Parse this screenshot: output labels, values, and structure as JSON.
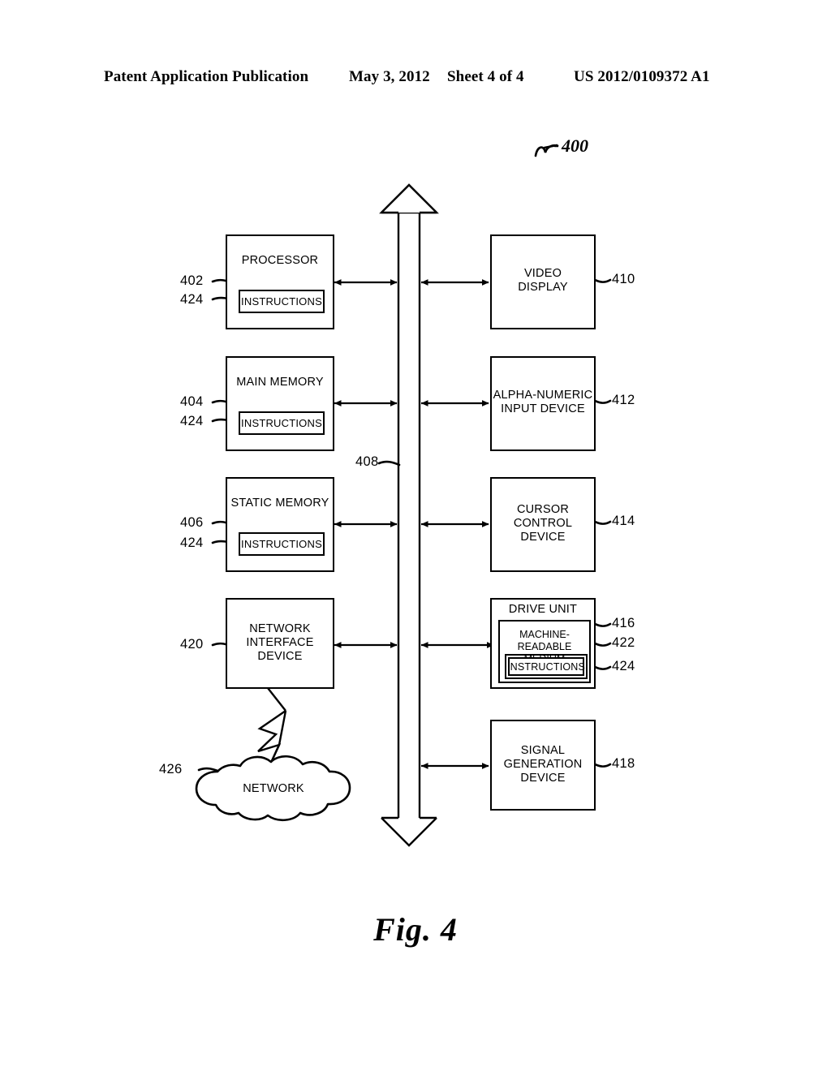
{
  "header": {
    "publication": "Patent Application Publication",
    "date": "May 3, 2012",
    "sheet": "Sheet 4 of 4",
    "patent_number": "US 2012/0109372 A1"
  },
  "figure": {
    "caption": "Fig. 4",
    "system_ref": "400",
    "bus_ref": "408",
    "bus_name": "bus"
  },
  "left_blocks": [
    {
      "title": "PROCESSOR",
      "ref": "402",
      "inner_label": "INSTRUCTIONS",
      "inner_ref": "424"
    },
    {
      "title": "MAIN MEMORY",
      "ref": "404",
      "inner_label": "INSTRUCTIONS",
      "inner_ref": "424"
    },
    {
      "title": "STATIC MEMORY",
      "ref": "406",
      "inner_label": "INSTRUCTIONS",
      "inner_ref": "424"
    },
    {
      "title": "NETWORK\nINTERFACE\nDEVICE",
      "ref": "420"
    }
  ],
  "right_blocks": [
    {
      "title": "VIDEO\nDISPLAY",
      "ref": "410"
    },
    {
      "title": "ALPHA-NUMERIC\nINPUT DEVICE",
      "ref": "412"
    },
    {
      "title": "CURSOR\nCONTROL\nDEVICE",
      "ref": "414"
    },
    {
      "title": "DRIVE UNIT",
      "ref": "416",
      "medium_label": "MACHINE-\nREADABLE MEDIUM",
      "medium_ref": "422",
      "inner_label": "INSTRUCTIONS",
      "inner_ref": "424"
    },
    {
      "title": "SIGNAL\nGENERATION\nDEVICE",
      "ref": "418"
    }
  ],
  "network": {
    "label": "NETWORK",
    "ref": "426"
  },
  "colors": {
    "ink": "#000000",
    "paper": "#ffffff"
  }
}
